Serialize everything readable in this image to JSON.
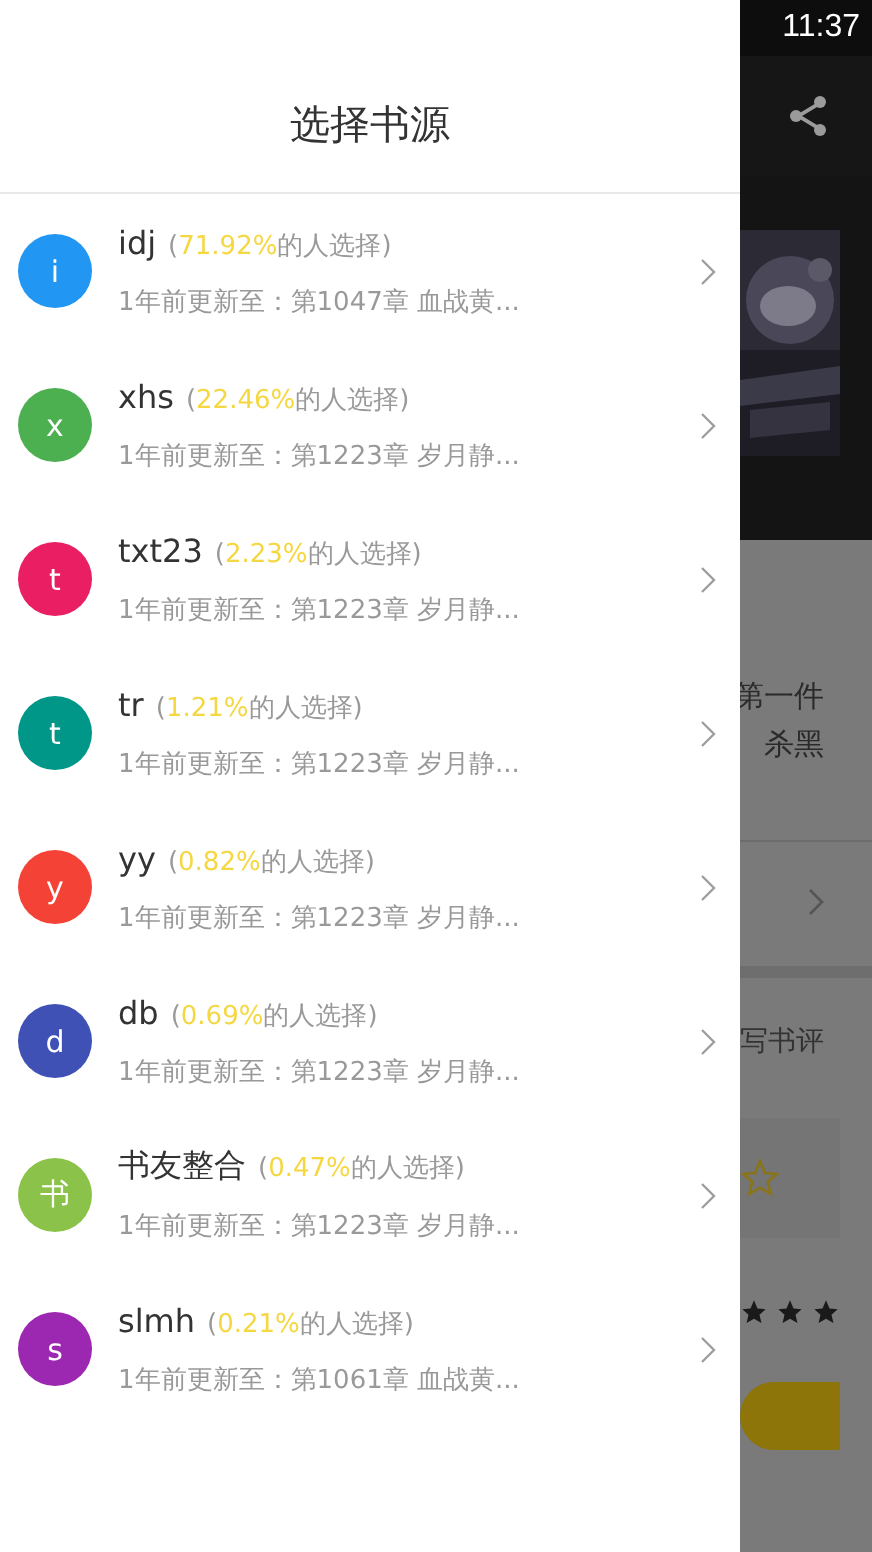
{
  "status_bar": {
    "time": "11:37"
  },
  "drawer": {
    "title": "选择书源",
    "sources": [
      {
        "avatar": "i",
        "color": "#2196f3",
        "name": "idj",
        "share_prefix": "(",
        "share": "71.92%",
        "share_suffix": "的人选择)",
        "update": "1年前更新至：第1047章 血战黄..."
      },
      {
        "avatar": "x",
        "color": "#4caf50",
        "name": "xhs",
        "share_prefix": "(",
        "share": "22.46%",
        "share_suffix": "的人选择)",
        "update": "1年前更新至：第1223章 岁月静..."
      },
      {
        "avatar": "t",
        "color": "#e91e63",
        "name": "txt23",
        "share_prefix": "(",
        "share": "2.23%",
        "share_suffix": "的人选择)",
        "update": "1年前更新至：第1223章 岁月静..."
      },
      {
        "avatar": "t",
        "color": "#009688",
        "name": "tr",
        "share_prefix": "(",
        "share": "1.21%",
        "share_suffix": "的人选择)",
        "update": "1年前更新至：第1223章 岁月静..."
      },
      {
        "avatar": "y",
        "color": "#f44336",
        "name": "yy",
        "share_prefix": "(",
        "share": "0.82%",
        "share_suffix": "的人选择)",
        "update": "1年前更新至：第1223章 岁月静..."
      },
      {
        "avatar": "d",
        "color": "#3f51b5",
        "name": "db",
        "share_prefix": "(",
        "share": "0.69%",
        "share_suffix": "的人选择)",
        "update": "1年前更新至：第1223章 岁月静..."
      },
      {
        "avatar": "书",
        "color": "#8bc34a",
        "name": "书友整合",
        "share_prefix": "(",
        "share": "0.47%",
        "share_suffix": "的人选择)",
        "update": "1年前更新至：第1223章 岁月静..."
      },
      {
        "avatar": "s",
        "color": "#9c27b0",
        "name": "slmh",
        "share_prefix": "(",
        "share": "0.21%",
        "share_suffix": "的人选择)",
        "update": "1年前更新至：第1061章 血战黄..."
      }
    ]
  },
  "background": {
    "intro_lines": [
      "第一件",
      "杀黑"
    ],
    "review_link": "写书评",
    "rating": {
      "stars": 3
    }
  }
}
